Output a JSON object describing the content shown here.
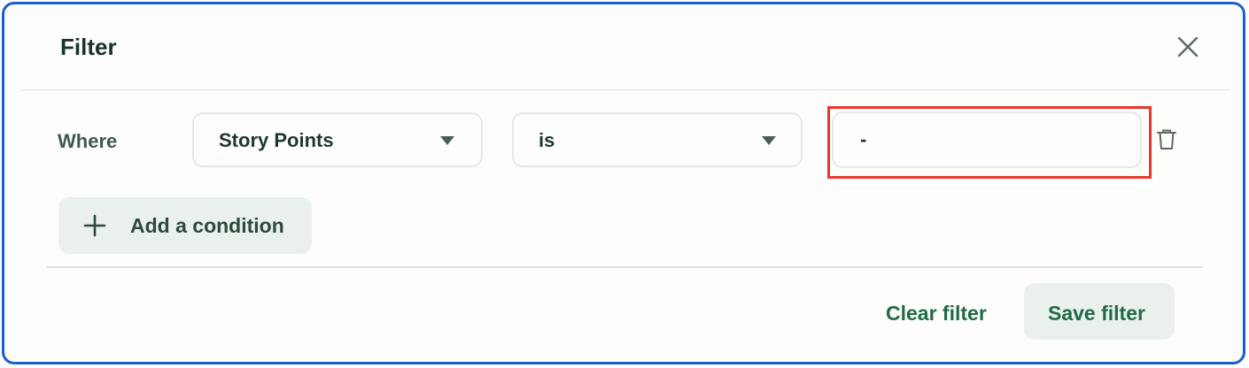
{
  "dialog": {
    "title": "Filter",
    "close_icon": "close-icon"
  },
  "condition": {
    "where_label": "Where",
    "field": "Story Points",
    "operator": "is",
    "value": "-",
    "delete_icon": "trash-icon"
  },
  "actions": {
    "add_condition": "Add a condition",
    "clear_filter": "Clear filter",
    "save_filter": "Save filter"
  },
  "colors": {
    "border": "#1a5fc7",
    "highlight": "#e8372c",
    "accent_text": "#1f6b45",
    "button_bg": "#eaf0ec"
  }
}
